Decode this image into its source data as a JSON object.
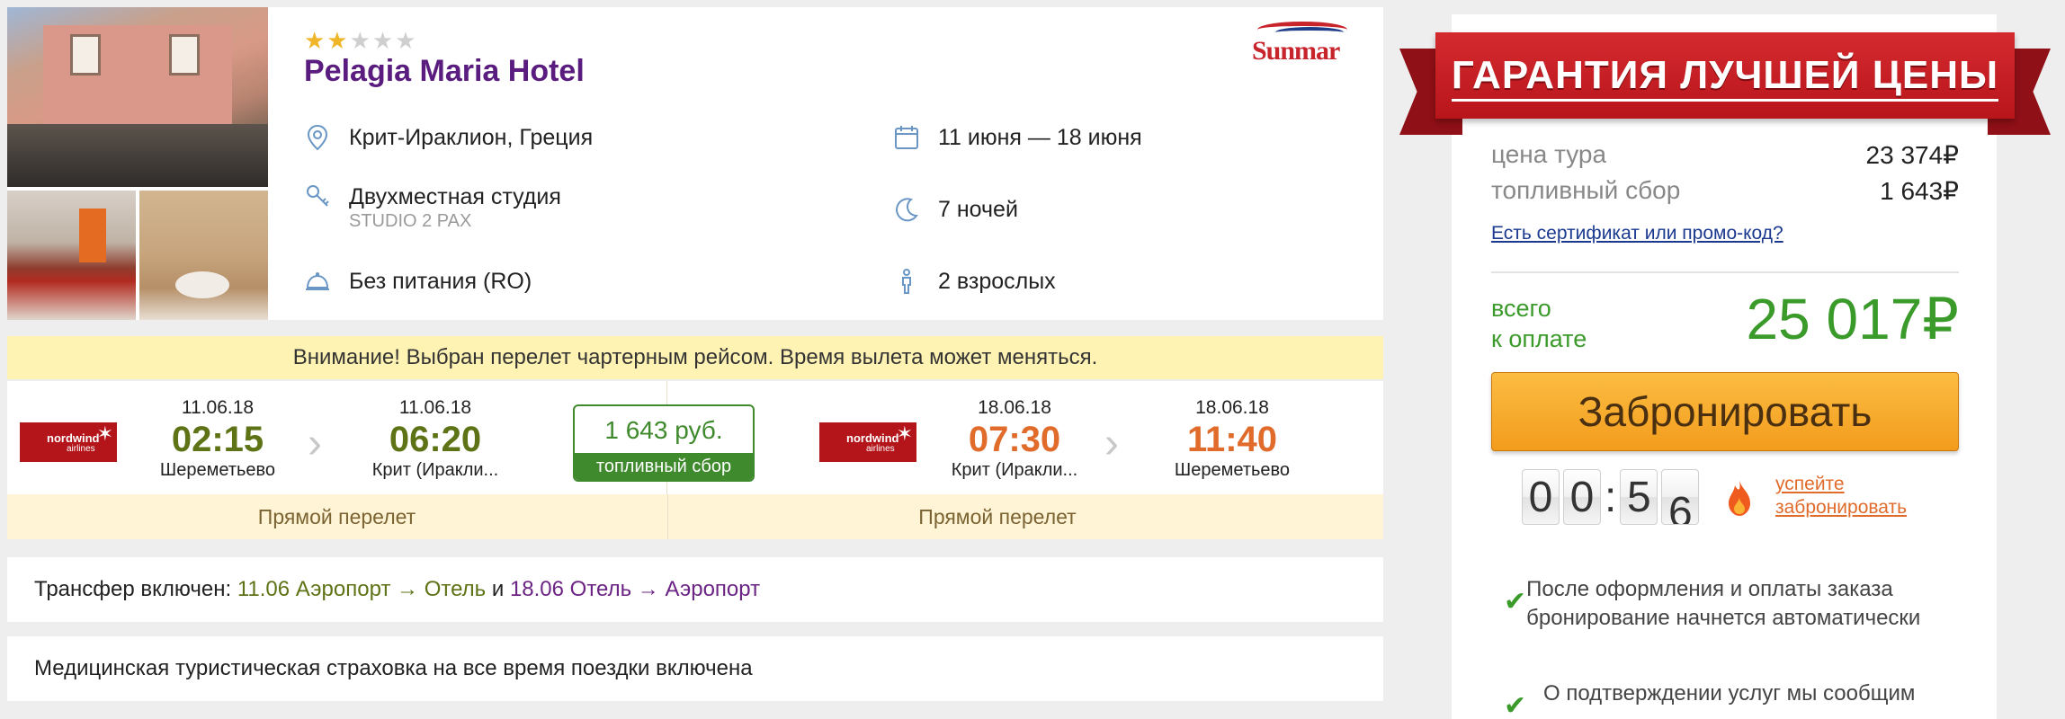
{
  "hotel": {
    "stars_filled": 2,
    "stars_total": 5,
    "stars_on": "★★",
    "stars_off": "★★★",
    "name": "Pelagia Maria Hotel",
    "operator_logo": "Sunmar",
    "location": "Крит-Ираклион, Греция",
    "room": "Двухместная студия",
    "room_code": "STUDIO 2 PAX",
    "meal": "Без питания (RO)",
    "dates": "11 июня — 18 июня",
    "nights": "7 ночей",
    "guests": "2 взрослых"
  },
  "notice": "Внимание! Выбран перелет чартерным рейсом. Время вылета может меняться.",
  "flights": {
    "airline_logo_line1": "nordwind",
    "airline_logo_line2": "airlines",
    "outbound": {
      "dep_date": "11.06.18",
      "dep_time": "02:15",
      "dep_airport": "Шереметьево",
      "arr_date": "11.06.18",
      "arr_time": "06:20",
      "arr_airport": "Крит (Иракли...",
      "type": "Прямой перелет"
    },
    "fuel": {
      "amount": "1 643 руб.",
      "label": "топливный сбор"
    },
    "return": {
      "dep_date": "18.06.18",
      "dep_time": "07:30",
      "dep_airport": "Крит (Иракли...",
      "arr_date": "18.06.18",
      "arr_time": "11:40",
      "arr_airport": "Шереметьево",
      "type": "Прямой перелет"
    },
    "colors": {
      "outbound": "#5d7316",
      "return": "#e06b2b"
    }
  },
  "transfer": {
    "prefix": "Трансфер включен:",
    "go": "11.06 Аэропорт → Отель",
    "joiner": "и",
    "back": "18.06 Отель → Аэропорт"
  },
  "insurance": "Медицинская туристическая страховка на все время поездки включена",
  "sidebar": {
    "ribbon": "ГАРАНТИЯ ЛУЧШЕЙ ЦЕНЫ",
    "tour_price_label": "цена тура",
    "tour_price_value": "23 374₽",
    "fuel_label": "топливный сбор",
    "fuel_value": "1 643₽",
    "promo_link": "Есть сертификат или промо-код?",
    "total_label_1": "всего",
    "total_label_2": "к оплате",
    "total_value": "25 017₽",
    "book_button": "Забронировать",
    "timer": [
      "0",
      "0",
      "5",
      "6"
    ],
    "timer_sep": ":",
    "hurry_1": "успейте",
    "hurry_2": "забронировать",
    "checks": [
      "После оформления и оплаты заказа бронирование начнется автоматически",
      "О подтверждении услуг мы сообщим"
    ],
    "accent_green": "#3a9a2a",
    "button_orange": "#f39c1c",
    "ribbon_red": "#c41f25"
  }
}
